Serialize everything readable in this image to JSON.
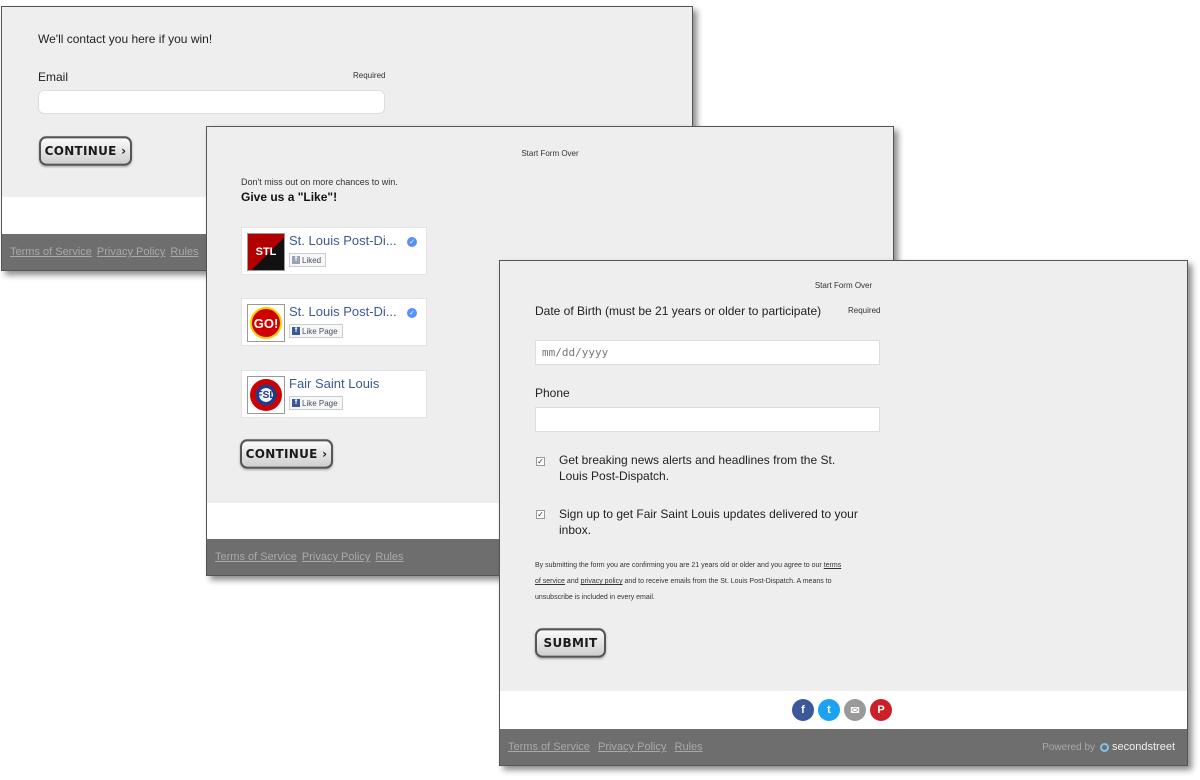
{
  "colors": {
    "panel_bg": "#eeeeee",
    "footer_bg": "#6e6e6e",
    "facebook_blue": "#3b5998",
    "twitter_blue": "#1da1f2",
    "email_gray": "#999999",
    "pinterest_red": "#cb2027"
  },
  "panel1": {
    "heading": "We'll contact you here if you win!",
    "email_label": "Email",
    "required": "Required",
    "email_value": "",
    "continue_label": "CONTINUE ›",
    "footer": {
      "terms": "Terms of Service",
      "privacy": "Privacy Policy",
      "rules": "Rules"
    }
  },
  "panel2": {
    "start_over": "Start Form Over",
    "missout": "Don't miss out on more chances to win.",
    "like_prompt": "Give us a \"Like\"!",
    "pages": [
      {
        "name": "St. Louis Post-Di...",
        "thumb_text": "STL",
        "button": "Liked",
        "verified": true,
        "icon": "stltoday-logo-icon"
      },
      {
        "name": "St. Louis Post-Di...",
        "thumb_text": "GO!",
        "button": "Like Page",
        "verified": true,
        "icon": "go-logo-icon"
      },
      {
        "name": "Fair Saint Louis",
        "thumb_text": "FSL",
        "button": "Like Page",
        "verified": false,
        "icon": "fair-saint-louis-logo-icon"
      }
    ],
    "continue_label": "CONTINUE ›",
    "footer": {
      "terms": "Terms of Service",
      "privacy": "Privacy Policy",
      "rules": "Rules"
    }
  },
  "panel3": {
    "start_over": "Start Form Over",
    "dob_label": "Date of Birth (must be 21 years or older to participate)",
    "required": "Required",
    "dob_placeholder": "mm/dd/yyyy",
    "phone_label": "Phone",
    "phone_value": "",
    "checkbox1": {
      "checked": true,
      "label": "Get breaking news alerts and headlines from the St. Louis Post-Dispatch."
    },
    "checkbox2": {
      "checked": true,
      "label": "Sign up to get Fair Saint Louis updates delivered to your inbox."
    },
    "legal": {
      "part1": "By submitting the form you are confirming you are 21 years old or older and you agree to our",
      "terms_link": "terms of service",
      "and": "and",
      "privacy_link": "privacy policy",
      "part2": "and to receive emails from the St. Louis Post-Dispatch. A means to unsubscribe is included in every email."
    },
    "submit_label": "SUBMIT",
    "social": [
      {
        "name": "facebook",
        "glyph": "f",
        "icon": "facebook-icon"
      },
      {
        "name": "twitter",
        "glyph": "t",
        "icon": "twitter-icon"
      },
      {
        "name": "email",
        "glyph": "✉",
        "icon": "email-icon"
      },
      {
        "name": "pinterest",
        "glyph": "P",
        "icon": "pinterest-icon"
      }
    ],
    "footer": {
      "terms": "Terms of Service",
      "privacy": "Privacy Policy",
      "rules": "Rules",
      "powered_by": "Powered by",
      "brand": "secondstreet"
    }
  }
}
